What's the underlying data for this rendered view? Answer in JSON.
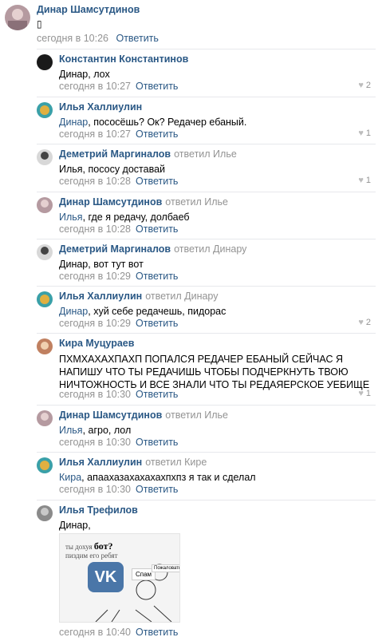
{
  "top_comment": {
    "author": "Динар Шамсутдинов",
    "text": "▯",
    "time": "сегодня в 10:26",
    "reply_label": "Ответить"
  },
  "replies": [
    {
      "author": "Константин Константинов",
      "replied_to": "",
      "mention": "",
      "text": "Динар, лох",
      "time": "сегодня в 10:27",
      "reply_label": "Ответить",
      "likes": "2"
    },
    {
      "author": "Илья Халлиулин",
      "replied_to": "",
      "mention": "Динар",
      "text": ", пососёшь? Ок? Редачер ебаный.",
      "time": "сегодня в 10:27",
      "reply_label": "Ответить",
      "likes": "1"
    },
    {
      "author": "Деметрий Маргиналов",
      "replied_to": "ответил Илье",
      "mention": "",
      "text": "Илья, пососу доставай",
      "time": "сегодня в 10:28",
      "reply_label": "Ответить",
      "likes": "1"
    },
    {
      "author": "Динар Шамсутдинов",
      "replied_to": "ответил Илье",
      "mention": "Илья",
      "text": ", где я редачу, долбаеб",
      "time": "сегодня в 10:28",
      "reply_label": "Ответить",
      "likes": ""
    },
    {
      "author": "Деметрий Маргиналов",
      "replied_to": "ответил Динару",
      "mention": "",
      "text": "Динар, вот тут вот",
      "time": "сегодня в 10:29",
      "reply_label": "Ответить",
      "likes": ""
    },
    {
      "author": "Илья Халлиулин",
      "replied_to": "ответил Динару",
      "mention": "Динар",
      "text": ", хуй себе редачешь, пидорас",
      "time": "сегодня в 10:29",
      "reply_label": "Ответить",
      "likes": "2"
    },
    {
      "author": "Кира Муцураев",
      "replied_to": "",
      "mention": "",
      "text": "ПХМХАХАХПАХП ПОПАЛСЯ РЕДАЧЕР ЕБАНЫЙ СЕЙЧАС Я НАПИШУ ЧТО ТЫ РЕДАЧИШЬ ЧТОБЫ ПОДЧЕРКНУТЬ ТВОЮ НИЧТОЖНОСТЬ И ВСЕ ЗНАЛИ ЧТО ТЫ РЕДАЯЕРСКОЕ УЕБИЩЕ",
      "time": "сегодня в 10:30",
      "reply_label": "Ответить",
      "likes": "1"
    },
    {
      "author": "Динар Шамсутдинов",
      "replied_to": "ответил Илье",
      "mention": "Илья",
      "text": ", агро, лол",
      "time": "сегодня в 10:30",
      "reply_label": "Ответить",
      "likes": ""
    },
    {
      "author": "Илья Халлиулин",
      "replied_to": "ответил Кире",
      "mention": "Кира",
      "text": ", апаахазахахахахпхпз я так и сделал",
      "time": "сегодня в 10:30",
      "reply_label": "Ответить",
      "likes": ""
    },
    {
      "author": "Илья Трефилов",
      "replied_to": "",
      "mention": "",
      "text": "Динар,",
      "time": "сегодня в 10:40",
      "reply_label": "Ответить",
      "likes": ""
    }
  ],
  "image": {
    "line1_small": "ты дохуя",
    "line1_big": "бот?",
    "line2": "пиздим его ребят",
    "logo": "VK",
    "spam": "Спам",
    "complain": "Пожаловаться"
  },
  "colors": {
    "link": "#2a5885",
    "muted": "#939393",
    "vk_blue": "#4a76a8"
  }
}
